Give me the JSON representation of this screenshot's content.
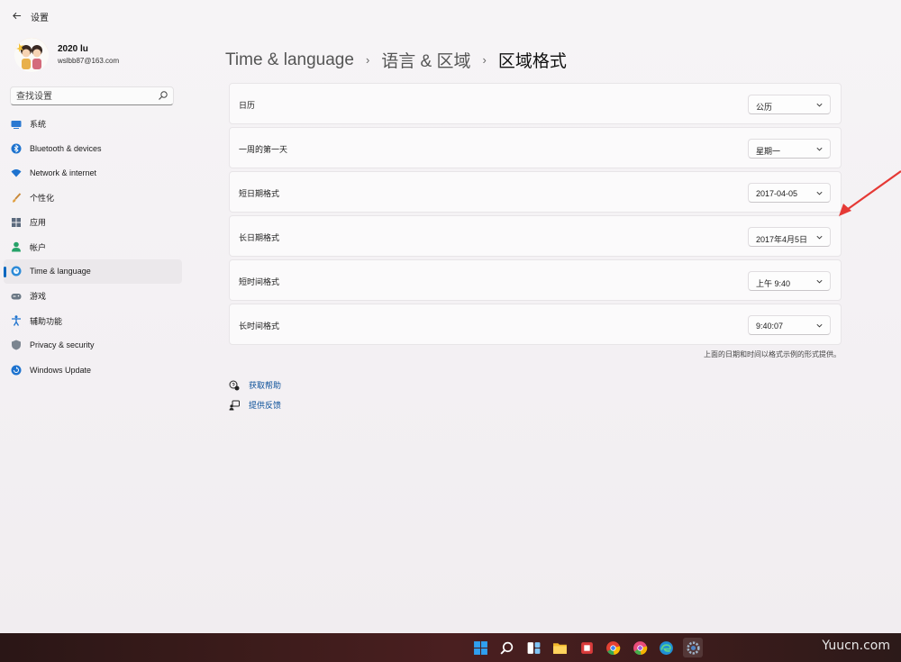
{
  "app": {
    "title": "设置"
  },
  "user": {
    "name": "2020 lu",
    "email": "wslbb87@163.com"
  },
  "search": {
    "placeholder": "查找设置"
  },
  "nav": {
    "items": [
      {
        "label": "系统",
        "icon": "monitor-icon",
        "active": false
      },
      {
        "label": "Bluetooth & devices",
        "icon": "bluetooth-icon",
        "active": false
      },
      {
        "label": "Network & internet",
        "icon": "wifi-icon",
        "active": false
      },
      {
        "label": "个性化",
        "icon": "brush-icon",
        "active": false
      },
      {
        "label": "应用",
        "icon": "apps-icon",
        "active": false
      },
      {
        "label": "帐户",
        "icon": "person-icon",
        "active": false
      },
      {
        "label": "Time & language",
        "icon": "globe-clock-icon",
        "active": true
      },
      {
        "label": "游戏",
        "icon": "gamepad-icon",
        "active": false
      },
      {
        "label": "辅助功能",
        "icon": "accessibility-icon",
        "active": false
      },
      {
        "label": "Privacy & security",
        "icon": "shield-icon",
        "active": false
      },
      {
        "label": "Windows Update",
        "icon": "update-icon",
        "active": false
      }
    ]
  },
  "breadcrumb": {
    "level1": "Time & language",
    "level2": "语言 & 区域",
    "current": "区域格式",
    "separator": "›"
  },
  "rows": [
    {
      "label": "日历",
      "value": "公历"
    },
    {
      "label": "一周的第一天",
      "value": "星期一"
    },
    {
      "label": "短日期格式",
      "value": "2017-04-05"
    },
    {
      "label": "长日期格式",
      "value": "2017年4月5日"
    },
    {
      "label": "短时间格式",
      "value": "上午 9:40"
    },
    {
      "label": "长时间格式",
      "value": "9:40:07"
    }
  ],
  "footnote": "上面的日期和时间以格式示例的形式提供。",
  "links": {
    "help": "获取帮助",
    "feedback": "提供反馈"
  },
  "taskbar": {
    "icons": [
      "windows-start-icon",
      "search-icon",
      "task-view-icon",
      "file-explorer-icon",
      "office-icon",
      "chrome-icon",
      "chrome-canary-icon",
      "edge-icon",
      "settings-icon"
    ]
  },
  "watermark": "Yuucn.com",
  "colors": {
    "accent": "#0067c0",
    "link": "#0a4f99",
    "annotation_arrow": "#e53935"
  }
}
